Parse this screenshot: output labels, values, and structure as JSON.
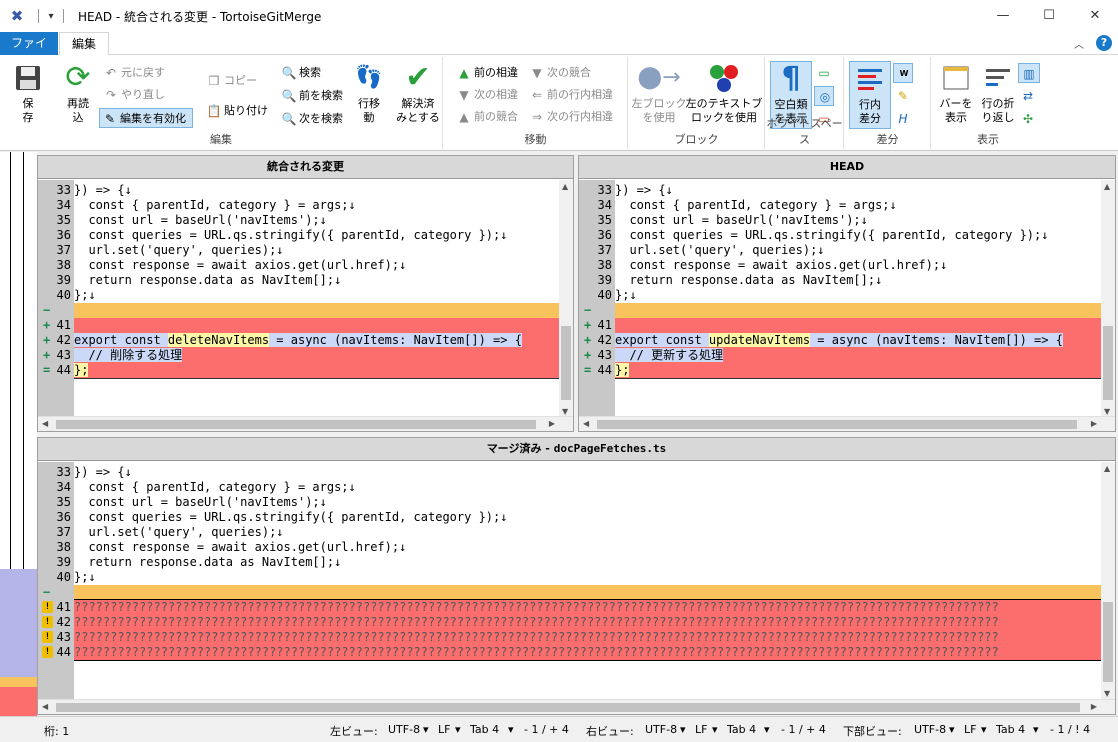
{
  "window": {
    "title": "HEAD - 統合される変更 - TortoiseGitMerge"
  },
  "tabs": {
    "file": "ファイル",
    "edit": "編集"
  },
  "ribbon": {
    "edit_group": {
      "label": "編集",
      "save": "保\n存",
      "reload": "再読\n込",
      "undo": "元に戻す",
      "redo": "やり直し",
      "enable_edit": "編集を有効化",
      "copy": "コピー",
      "paste": "貼り付け",
      "search": "検索",
      "search_prev": "前を検索",
      "search_next": "次を検索",
      "goto_line": "行移\n動",
      "resolve": "解決済\nみとする"
    },
    "move_group": {
      "label": "移動",
      "prev_diff": "前の相違",
      "next_conflict": "次の競合",
      "next_diff": "次の相違",
      "prev_line_diff": "前の行内相違",
      "prev_conflict": "前の競合",
      "next_line_diff": "次の行内相違"
    },
    "block_group": {
      "label": "ブロック",
      "use_left": "左ブロック\nを使用",
      "use_left_text": "左のテキストブ\nロックを使用"
    },
    "ws_group": {
      "label": "ホワイトスペース",
      "show_ws": "空白類\nを表示"
    },
    "diff_group": {
      "label": "差分",
      "inline": "行内\n差分"
    },
    "view_group": {
      "label": "表示",
      "show_bar": "バーを\n表示",
      "wrap": "行の折\nり返し"
    }
  },
  "panes": {
    "left": {
      "header": "統合される変更"
    },
    "right": {
      "header": "HEAD"
    },
    "bottom": {
      "header_label": "マージ済み",
      "header_sep": " - ",
      "header_file": "docPageFetches.ts"
    }
  },
  "common_lines": [
    {
      "n": "33",
      "t": "}) => {↓"
    },
    {
      "n": "34",
      "t": "  const { parentId, category } = args;↓"
    },
    {
      "n": "35",
      "t": "  const url = baseUrl('navItems');↓"
    },
    {
      "n": "36",
      "t": "  const queries = URL.qs.stringify({ parentId, category });↓"
    },
    {
      "n": "37",
      "t": "  url.set('query', queries);↓"
    },
    {
      "n": "38",
      "t": "  const response = await axios.get(url.href);↓"
    },
    {
      "n": "39",
      "t": "  return response.data as NavItem[];↓"
    },
    {
      "n": "40",
      "t": "};↓"
    }
  ],
  "left_changed": {
    "line41": "",
    "line42_pre": "export const ",
    "line42_name": "deleteNavItems",
    "line42_post": " = async (navItems: NavItem[]) => {",
    "line43": "  // 削除する処理",
    "line44": "};"
  },
  "right_changed": {
    "line42_pre": "export const ",
    "line42_name": "updateNavItems",
    "line42_post": " = async (navItems: NavItem[]) => {",
    "line43": "  // 更新する処理",
    "line44": "};"
  },
  "changed_numbers": [
    "41",
    "42",
    "43",
    "44"
  ],
  "conflict_text": "????????????????????????????????????????????????????????????????????????????????????????????????????????????????????????????????",
  "status": {
    "col": "桁: 1",
    "left_view": "左ビュー:",
    "right_view": "右ビュー:",
    "bottom_view": "下部ビュー:",
    "enc": "UTF-8",
    "eol": "LF",
    "tab": "Tab 4",
    "left_count": "- 1 / + 4",
    "right_count": "- 1 / + 4",
    "bottom_count": "- 1 / ! 4"
  },
  "colors": {
    "accent": "#1979ca",
    "added": "#fc6e6e",
    "empty": "#f8c25c"
  }
}
